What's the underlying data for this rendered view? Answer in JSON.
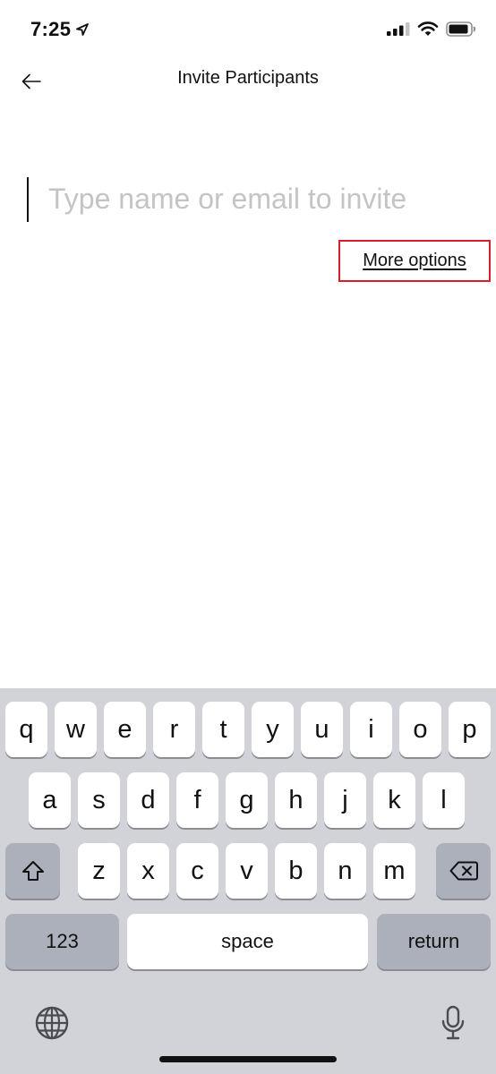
{
  "status_bar": {
    "time": "7:25",
    "icons": [
      "location-arrow-icon",
      "cellular-signal-icon",
      "wifi-icon",
      "battery-icon"
    ]
  },
  "header": {
    "back_icon": "arrow-left-icon",
    "title": "Invite Participants"
  },
  "invite": {
    "placeholder": "Type name or email to invite",
    "value": ""
  },
  "more_options": {
    "label": "More options",
    "highlight_color": "#d5202a"
  },
  "keyboard": {
    "row1": [
      "q",
      "w",
      "e",
      "r",
      "t",
      "y",
      "u",
      "i",
      "o",
      "p"
    ],
    "row2": [
      "a",
      "s",
      "d",
      "f",
      "g",
      "h",
      "j",
      "k",
      "l"
    ],
    "row3": [
      "z",
      "x",
      "c",
      "v",
      "b",
      "n",
      "m"
    ],
    "shift_icon": "shift-icon",
    "delete_icon": "backspace-icon",
    "numbers_label": "123",
    "space_label": "space",
    "return_label": "return",
    "globe_icon": "globe-icon",
    "mic_icon": "microphone-icon"
  }
}
